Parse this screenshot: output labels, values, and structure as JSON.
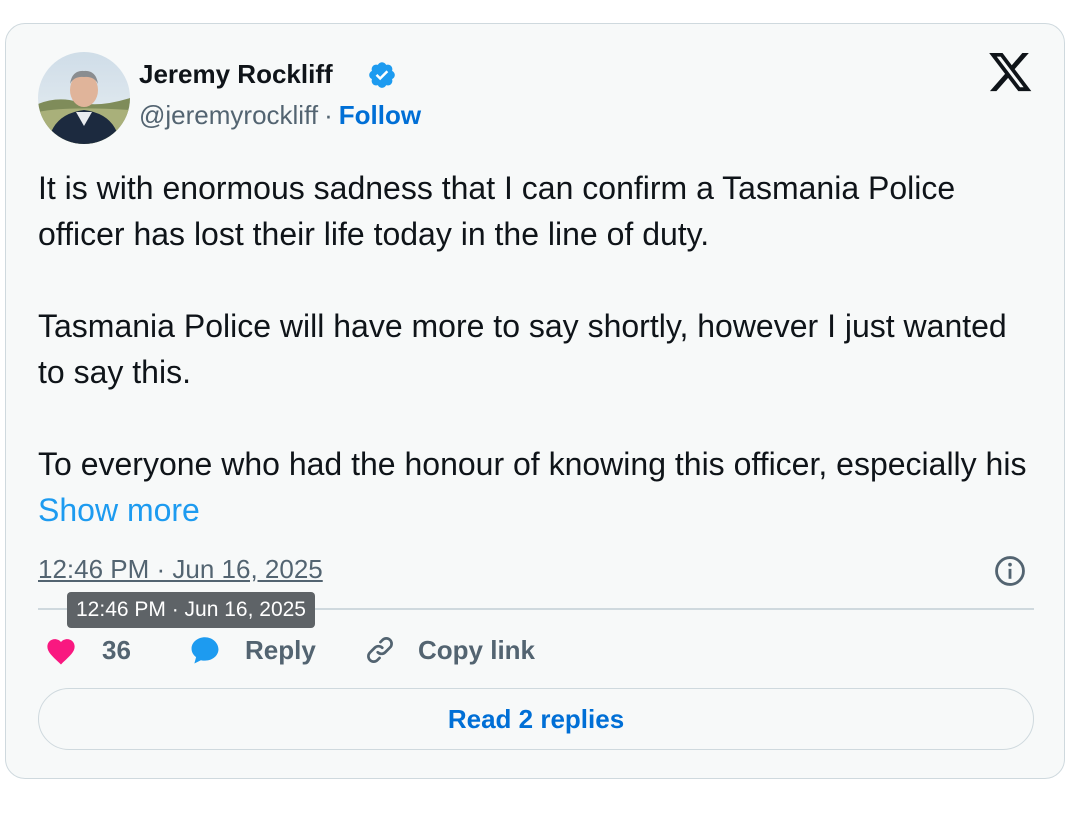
{
  "author": {
    "name": "Jeremy Rockliff",
    "handle": "@jeremyrockliff",
    "separator": "·",
    "follow_label": "Follow",
    "verified_color": "#1d9bf0"
  },
  "tweet": {
    "paragraph1": "It is with enormous sadness that I can confirm a Tasmania Police officer has lost their life today in the line of duty.",
    "paragraph2": "Tasmania Police will have more to say shortly, however I just wanted to say this.",
    "paragraph3": "To everyone who had the honour of knowing this officer, especially his",
    "show_more_label": "Show more",
    "timestamp": "12:46 PM · Jun 16, 2025"
  },
  "tooltip": {
    "text": "12:46 PM · Jun 16, 2025"
  },
  "actions": {
    "like_count": "36",
    "reply_label": "Reply",
    "copy_link_label": "Copy link",
    "like_color": "#f91880",
    "reply_color": "#1d9bf0"
  },
  "footer": {
    "read_replies_label": "Read 2 replies"
  },
  "icons": {
    "brand": "x-logo-icon",
    "verified": "verified-badge-icon",
    "info": "info-icon",
    "like": "heart-icon",
    "reply": "speech-bubble-icon",
    "copy": "link-icon"
  }
}
